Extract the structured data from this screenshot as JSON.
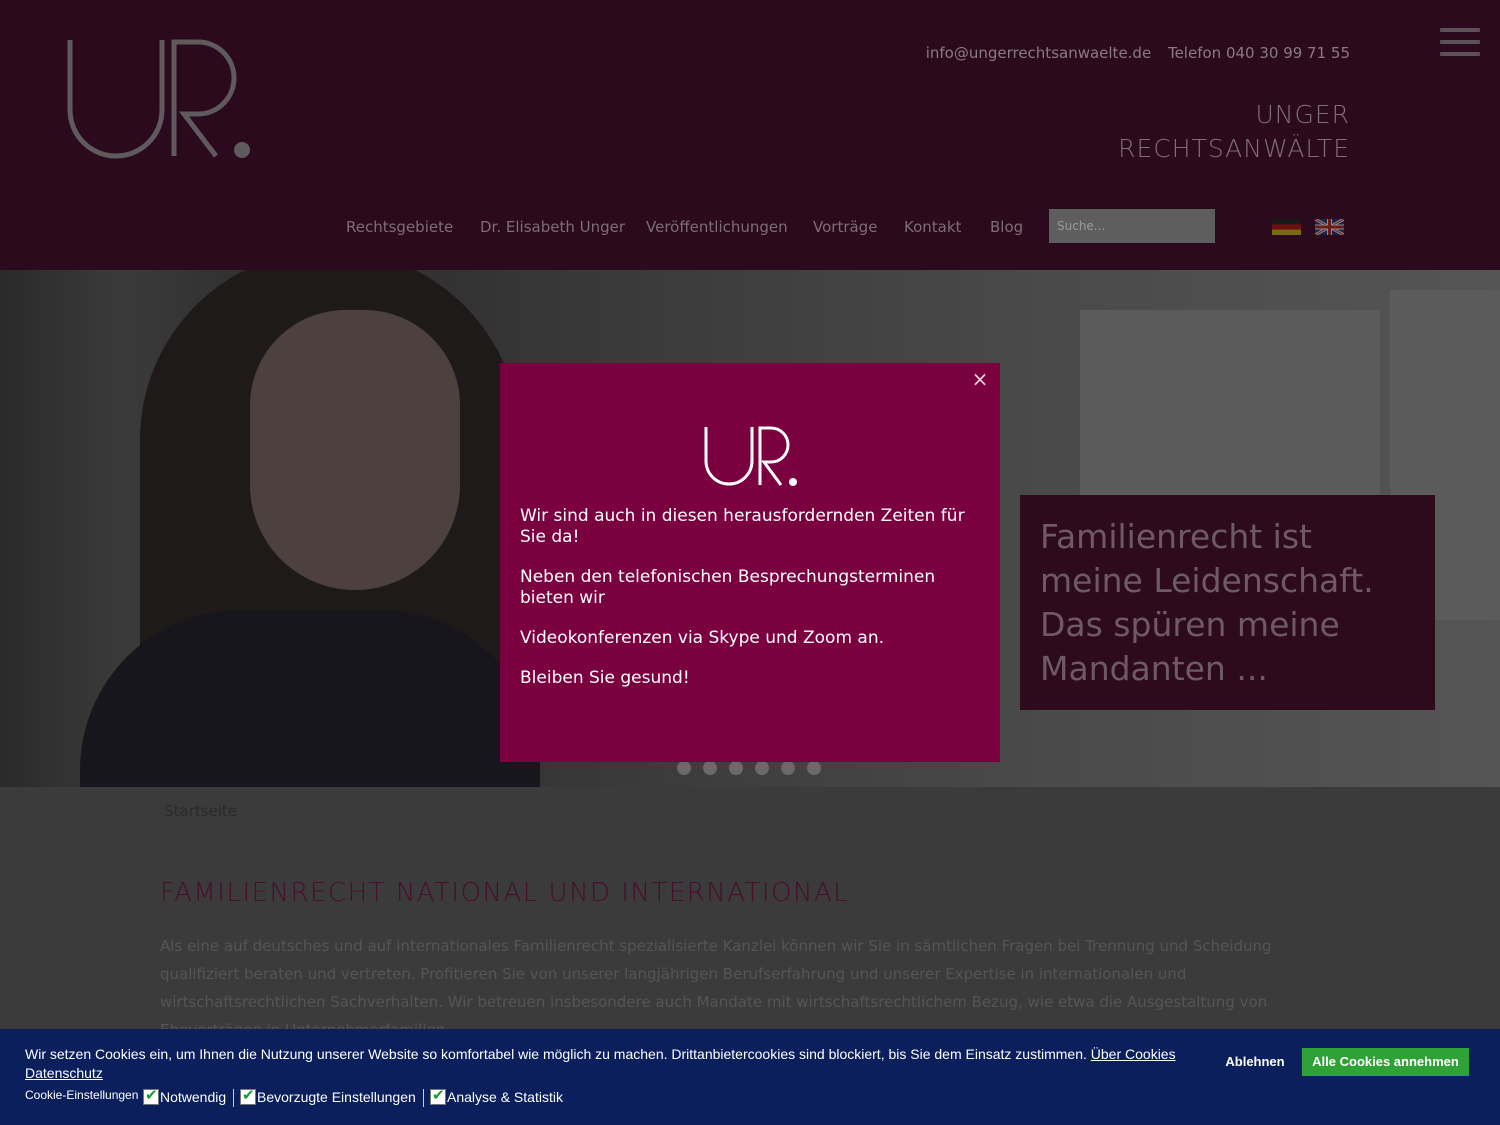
{
  "header": {
    "email": "info@ungerrechtsanwaelte.de",
    "phone": "Telefon 040 30 99 71 55",
    "brand_line1": "UNGER",
    "brand_line2": "RECHTSANWÄLTE"
  },
  "nav": {
    "items": [
      "Rechtsgebiete",
      "Dr. Elisabeth Unger",
      "Veröffentlichungen",
      "Vorträge",
      "Kontakt",
      "Blog"
    ],
    "search_placeholder": "Suche..."
  },
  "hero": {
    "quote": "Familienrecht ist meine Leidenschaft. Das spüren meine Mandanten ...",
    "slide_count": 6
  },
  "breadcrumb": "Startseite",
  "main": {
    "title": "FAMILIENRECHT NATIONAL UND INTERNATIONAL",
    "intro": "Als eine auf deutsches und auf internationales Familienrecht spezialisierte Kanzlei können wir Sie in sämtlichen Fragen bei Trennung und Scheidung qualifiziert beraten und vertreten. Profitieren Sie von unserer langjährigen Berufserfahrung und unserer Expertise in internationalen und wirtschaftsrechtlichen Sachverhalten. Wir betreuen insbesondere auch Mandate mit wirtschaftsrechtlichem Bezug, wie etwa die Ausgestaltung von Eheverträgen in Unternehmerfamilien."
  },
  "modal": {
    "close": "×",
    "p1": "Wir sind auch in diesen herausfordernden Zeiten für Sie da!",
    "p2": "Neben den telefonischen Besprechungsterminen bieten wir",
    "p3": "Videokonferenzen via Skype und Zoom an.",
    "p4": "Bleiben Sie gesund!"
  },
  "cookie": {
    "text": "Wir setzen Cookies ein, um Ihnen die Nutzung unserer Website so komfortabel wie möglich zu machen. Drittanbietercookies sind blockiert, bis Sie dem Einsatz zustimmen.",
    "link_about": "Über Cookies",
    "link_privacy": "Datenschutz",
    "settings_label": "Cookie-Einstellungen",
    "opt1": "Notwendig",
    "opt2": "Bevorzugte Einstellungen",
    "opt3": "Analyse & Statistik",
    "decline": "Ablehnen",
    "accept": "Alle Cookies annehmen"
  },
  "colors": {
    "header_bg": "#2c0a1e",
    "modal_bg": "#7a0040",
    "cookie_bg": "#0a1f5c",
    "accept_btn": "#2ea236"
  }
}
